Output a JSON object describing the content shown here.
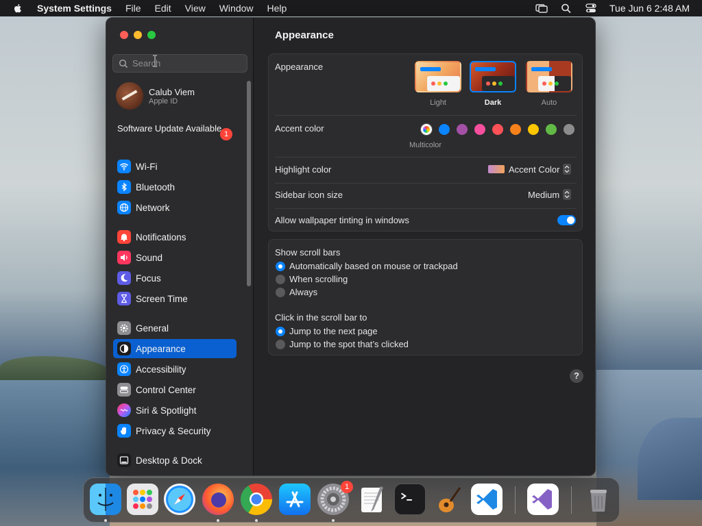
{
  "menubar": {
    "app_name": "System Settings",
    "menus": [
      "File",
      "Edit",
      "View",
      "Window",
      "Help"
    ],
    "clock": "Tue Jun 6  2:48 AM"
  },
  "sidebar": {
    "search_placeholder": "Search",
    "profile": {
      "name": "Calub Viem",
      "subtitle": "Apple ID"
    },
    "update": {
      "label": "Software Update Available",
      "badge": "1"
    },
    "items": [
      {
        "label": "Wi-Fi",
        "icon": "wifi-icon",
        "color": "#0a84ff"
      },
      {
        "label": "Bluetooth",
        "icon": "bluetooth-icon",
        "color": "#0a84ff"
      },
      {
        "label": "Network",
        "icon": "globe-icon",
        "color": "#0a84ff"
      },
      {
        "label": "Notifications",
        "icon": "bell-icon",
        "color": "#ff453a"
      },
      {
        "label": "Sound",
        "icon": "speaker-icon",
        "color": "#ff375f"
      },
      {
        "label": "Focus",
        "icon": "moon-icon",
        "color": "#5e5ce6"
      },
      {
        "label": "Screen Time",
        "icon": "hourglass-icon",
        "color": "#5e5ce6"
      },
      {
        "label": "General",
        "icon": "gear-icon",
        "color": "#8e8e93"
      },
      {
        "label": "Appearance",
        "icon": "appearance-icon",
        "color": "#1c1c1e"
      },
      {
        "label": "Accessibility",
        "icon": "accessibility-icon",
        "color": "#0a84ff"
      },
      {
        "label": "Control Center",
        "icon": "switches-icon",
        "color": "#8e8e93"
      },
      {
        "label": "Siri & Spotlight",
        "icon": "siri-icon",
        "color": "#bf5af2"
      },
      {
        "label": "Privacy & Security",
        "icon": "hand-icon",
        "color": "#0a84ff"
      },
      {
        "label": "Desktop & Dock",
        "icon": "dock-icon",
        "color": "#1c1c1e"
      }
    ],
    "active_item": "Appearance"
  },
  "content": {
    "title": "Appearance",
    "appearance": {
      "label": "Appearance",
      "options": [
        {
          "label": "Light"
        },
        {
          "label": "Dark"
        },
        {
          "label": "Auto"
        }
      ],
      "selected": "Dark"
    },
    "accent": {
      "label": "Accent color",
      "colors": [
        "#0a84ff",
        "#a550a7",
        "#f74f9e",
        "#ff5257",
        "#f7821b",
        "#ffc600",
        "#62ba46",
        "#8c8c8c"
      ],
      "selected_label": "Multicolor"
    },
    "highlight": {
      "label": "Highlight color",
      "value": "Accent Color"
    },
    "icon_size": {
      "label": "Sidebar icon size",
      "value": "Medium"
    },
    "tinting": {
      "label": "Allow wallpaper tinting in windows",
      "enabled": true
    },
    "scroll_bars": {
      "label": "Show scroll bars",
      "options": [
        "Automatically based on mouse or trackpad",
        "When scrolling",
        "Always"
      ],
      "selected": 0
    },
    "click_scroll": {
      "label": "Click in the scroll bar to",
      "options": [
        "Jump to the next page",
        "Jump to the spot that’s clicked"
      ],
      "selected": 0
    },
    "help": "?"
  },
  "dock": {
    "apps": [
      "finder-icon",
      "launchpad-icon",
      "safari-icon",
      "firefox-icon",
      "chrome-icon",
      "app-store-icon",
      "system-settings-icon",
      "textedit-icon",
      "terminal-icon",
      "garageband-icon",
      "vscode-icon",
      "visual-studio-icon",
      "trash-icon"
    ],
    "settings_badge": "1"
  }
}
